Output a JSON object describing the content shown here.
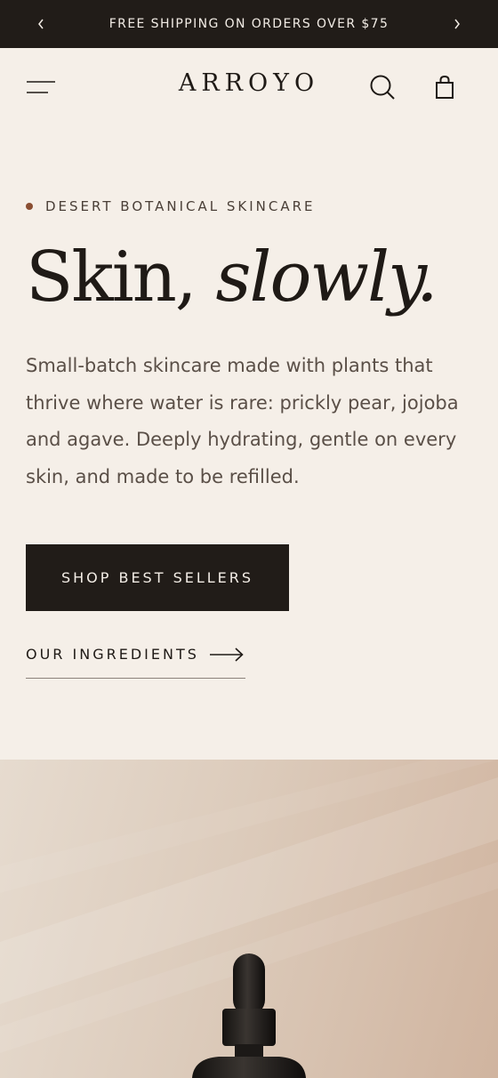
{
  "announcement": {
    "text": "FREE SHIPPING ON ORDERS OVER $75"
  },
  "header": {
    "brand": "ARROYO"
  },
  "hero": {
    "eyebrow": "DESERT BOTANICAL SKINCARE",
    "headline_plain": "Skin, ",
    "headline_italic": "slowly.",
    "description": "Small-batch skincare made with plants that thrive where water is rare: prickly pear, jojoba and agave. Deeply hydrating, gentle on every skin, and made to be refilled.",
    "primary_cta": "SHOP BEST SELLERS",
    "secondary_cta": "OUR INGREDIENTS"
  },
  "colors": {
    "background": "#f5efe8",
    "dark": "#211c18",
    "accent_dot": "#8a4e32"
  },
  "icons": [
    "chevron-left-icon",
    "chevron-right-icon",
    "menu-icon",
    "search-icon",
    "shopping-bag-icon",
    "arrow-right-icon"
  ]
}
